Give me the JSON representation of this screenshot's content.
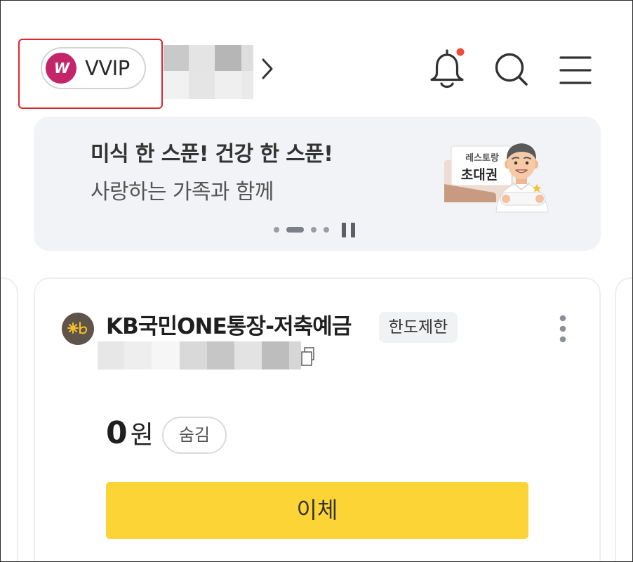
{
  "header": {
    "grade_badge": {
      "label": "VVIP",
      "logo_text": "W",
      "logo_color": "#c4246a"
    },
    "highlight_color": "#e0262c",
    "icons": {
      "grade_logo": "vvip-logo-icon",
      "profile_arrow": "chevron-right-icon",
      "notification": "bell-icon",
      "search": "search-icon",
      "menu": "menu-icon"
    },
    "notification_dot_color": "#ef4b3b"
  },
  "banner": {
    "title": "미식 한 스푼! 건강 한 스푼!",
    "subtitle": "사랑하는 가족과 함께",
    "illustration": {
      "coupon_top": "레스토랑",
      "coupon_main": "초대권"
    },
    "pagination": {
      "total": 4,
      "active": 1
    },
    "background_color": "#f2f3f6"
  },
  "account_card": {
    "logo_icon": "kb-star-logo-icon",
    "name": "KB국민ONE통장-저축예금",
    "tag": "한도제한",
    "balance": {
      "amount": "0",
      "unit": "원"
    },
    "hide_toggle_label": "숨김",
    "transfer_button_label": "이체",
    "transfer_button_color": "#fdd435"
  }
}
